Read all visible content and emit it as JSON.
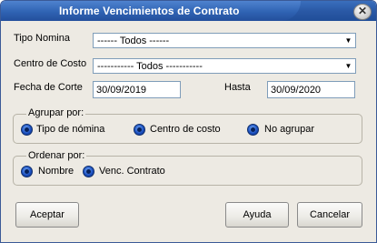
{
  "window": {
    "title": "Informe Vencimientos de Contrato",
    "close_label": "✕"
  },
  "form": {
    "tipo_nomina_label": "Tipo Nomina",
    "tipo_nomina_value": "------ Todos ------",
    "centro_costo_label": "Centro de Costo",
    "centro_costo_value": "----------- Todos -----------",
    "fecha_corte_label": "Fecha de Corte",
    "fecha_corte_value": "30/09/2019",
    "hasta_label": "Hasta",
    "hasta_value": "30/09/2020",
    "dropdown_arrow": "▼"
  },
  "agrupar": {
    "title": "Agrupar por:",
    "options": [
      "Tipo de nómina",
      "Centro de costo",
      "No agrupar"
    ]
  },
  "ordenar": {
    "title": "Ordenar por:",
    "options": [
      "Nombre",
      "Venc. Contrato"
    ]
  },
  "buttons": {
    "accept": "Aceptar",
    "help": "Ayuda",
    "cancel": "Cancelar"
  }
}
